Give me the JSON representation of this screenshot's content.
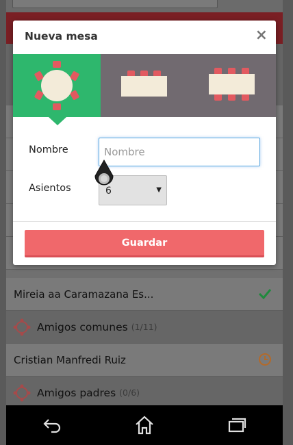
{
  "modal": {
    "title": "Nueva mesa",
    "close_label": "×",
    "table_types": [
      "round-table",
      "rectangular-table-small",
      "rectangular-table-large"
    ],
    "selected_table_type": "round-table",
    "name_label": "Nombre",
    "name_placeholder": "Nombre",
    "name_value": "",
    "seats_label": "Asientos",
    "seats_value": "6",
    "save_label": "Guardar"
  },
  "list": {
    "items": [
      {
        "type": "guest",
        "name": "Mireia aa Caramazana Es...",
        "status": "confirmed"
      },
      {
        "type": "group",
        "name": "Amigos comunes",
        "count": "(1/11)"
      },
      {
        "type": "guest",
        "name": "Cristian Manfredi Ruiz",
        "status": "pending"
      },
      {
        "type": "group",
        "name": "Amigos padres",
        "count": "(0/6)"
      }
    ]
  },
  "colors": {
    "accent_green": "#2eb76d",
    "save_red": "#f0686b",
    "picker_bg": "#716a70",
    "table_fill": "#f3ebd9",
    "chair_red": "#e25a60"
  },
  "icons": {
    "back": "back-arrow-icon",
    "home": "home-icon",
    "recent": "recent-apps-icon",
    "check": "check-icon",
    "clock": "clock-icon"
  }
}
